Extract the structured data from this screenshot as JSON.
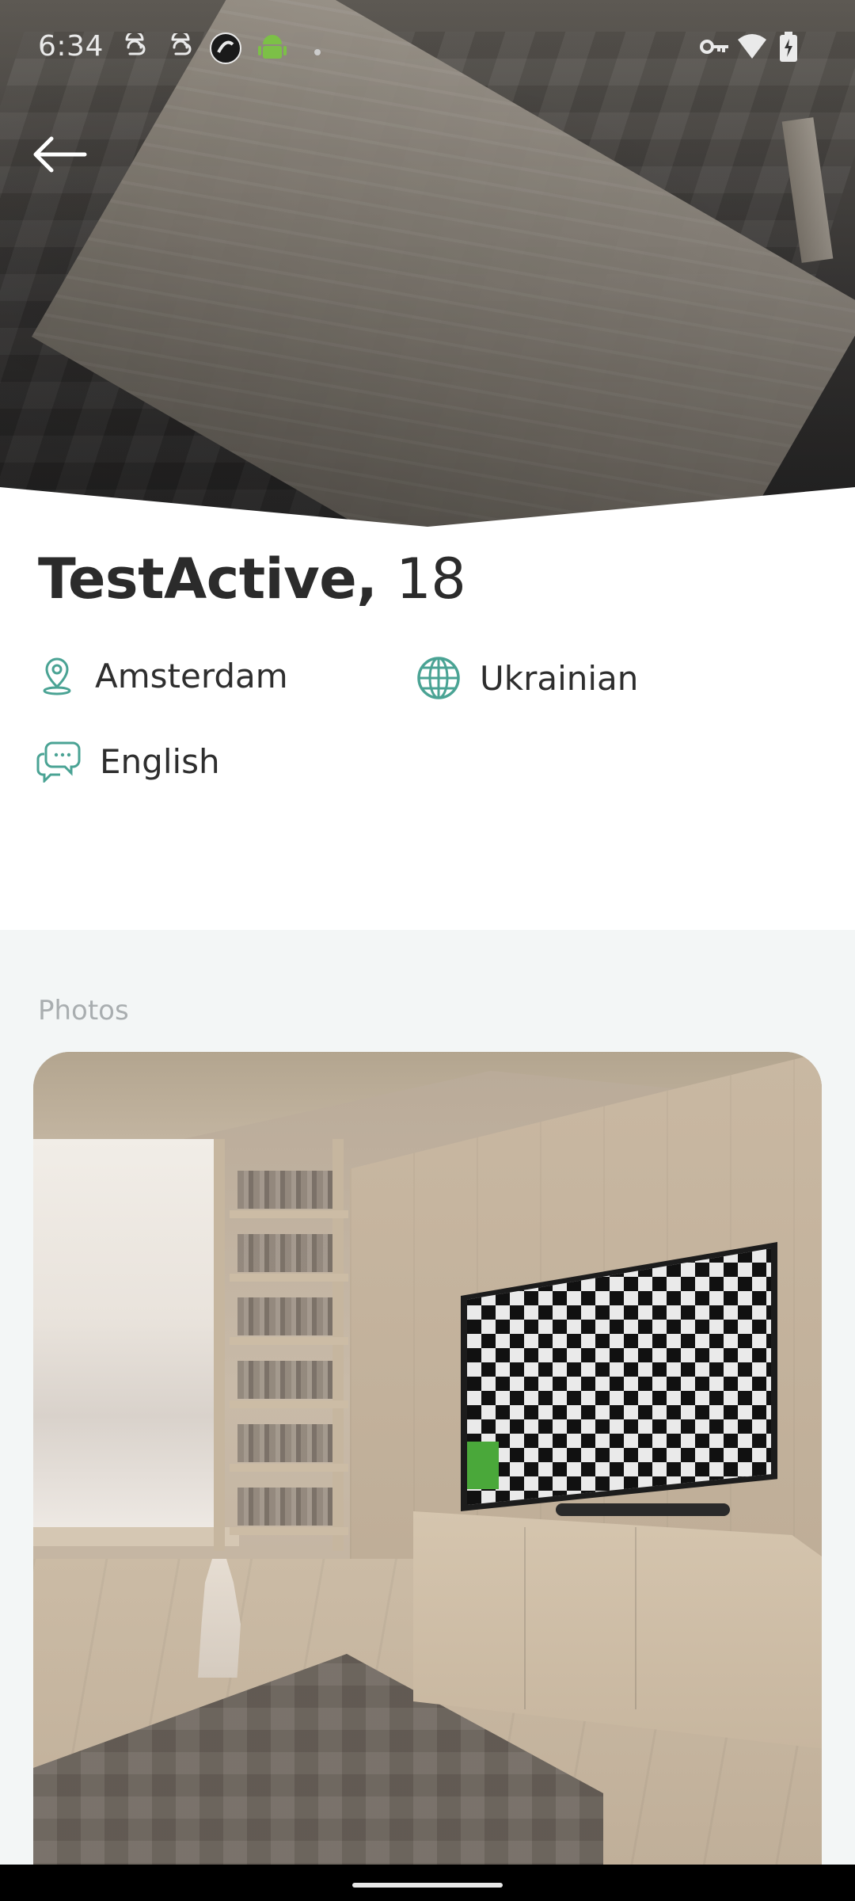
{
  "status_bar": {
    "time": "6:34",
    "left_icons": [
      "notification-s-icon",
      "notification-s-icon",
      "circle-app-icon",
      "android-icon",
      "dot-icon"
    ],
    "right_icons": [
      "vpn-key-icon",
      "wifi-icon",
      "battery-charging-icon"
    ]
  },
  "header": {
    "back_icon": "arrow-left-icon"
  },
  "profile": {
    "name": "TestActive,",
    "age": "18",
    "city": "Amsterdam",
    "nationality": "Ukrainian",
    "language": "English"
  },
  "photos": {
    "label": "Photos"
  },
  "colors": {
    "accent": "#4aa394",
    "section_bg": "#f3f6f6",
    "text_primary": "#2b2b2b",
    "label_gray": "#a9aeb0"
  }
}
